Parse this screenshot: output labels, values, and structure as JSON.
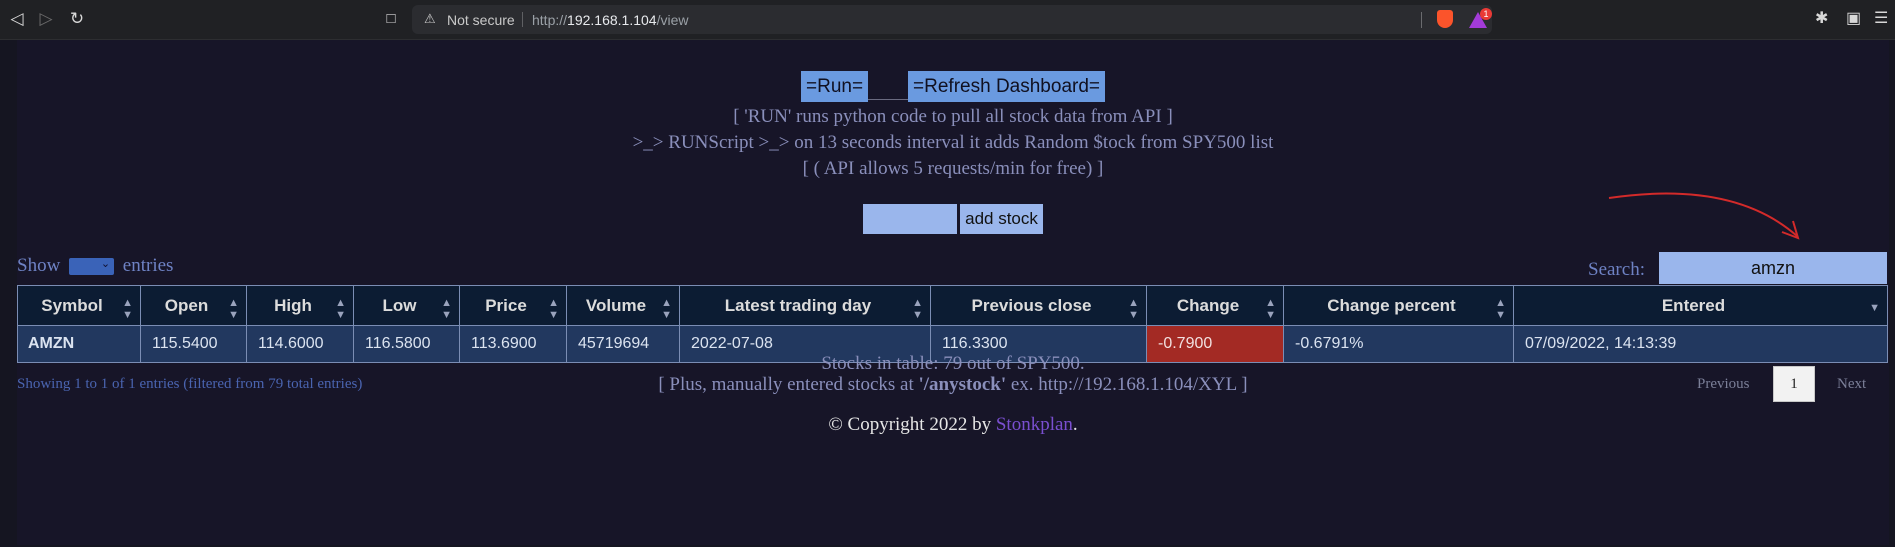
{
  "browser": {
    "security_label": "Not secure",
    "url_scheme": "http://",
    "url_host": "192.168.1.104",
    "url_path": "/view",
    "rewards_badge": "1"
  },
  "controls": {
    "run_label": "=Run=",
    "refresh_label": "=Refresh Dashboard="
  },
  "description": {
    "line1": "[ 'RUN' runs python code to pull all stock data from API ]",
    "line2": ">_> RUNScript >_> on 13 seconds interval it adds Random $tock from SPY500 list",
    "line3": "[ ( API allows 5 requests/min for free) ]"
  },
  "add_stock": {
    "input_value": "",
    "button_label": "add stock"
  },
  "table_controls": {
    "show_label": "Show",
    "entries_label": "entries",
    "search_label": "Search:",
    "search_value": "amzn"
  },
  "table": {
    "columns": [
      "Symbol",
      "Open",
      "High",
      "Low",
      "Price",
      "Volume",
      "Latest trading day",
      "Previous close",
      "Change",
      "Change percent",
      "Entered"
    ],
    "rows": [
      [
        "AMZN",
        "115.5400",
        "114.6000",
        "116.5800",
        "113.6900",
        "45719694",
        "2022-07-08",
        "116.3300",
        "-0.7900",
        "-0.6791%",
        "07/09/2022, 14:13:39"
      ]
    ]
  },
  "pagination": {
    "info": "Showing 1 to 1 of 1 entries (filtered from 79 total entries)",
    "previous": "Previous",
    "page": "1",
    "next": "Next"
  },
  "footer": {
    "stocks_count": "Stocks in table: 79 out of SPY500.",
    "manual_prefix": "[ Plus, manually entered stocks at ",
    "manual_route": "'/anystock'",
    "manual_suffix": " ex. http://192.168.1.104/XYL ]",
    "copyright_prefix": "© Copyright 2022 by ",
    "copyright_link": "Stonkplan",
    "copyright_suffix": "."
  },
  "colors": {
    "page_bg": "#171528",
    "button_blue": "#6a9ae0",
    "input_blue": "#9ab6ec",
    "header_bg": "#0c1c33",
    "row_bg": "#22385f",
    "negative_change": "#a32a24",
    "annotation_arrow": "#d32a2a"
  }
}
